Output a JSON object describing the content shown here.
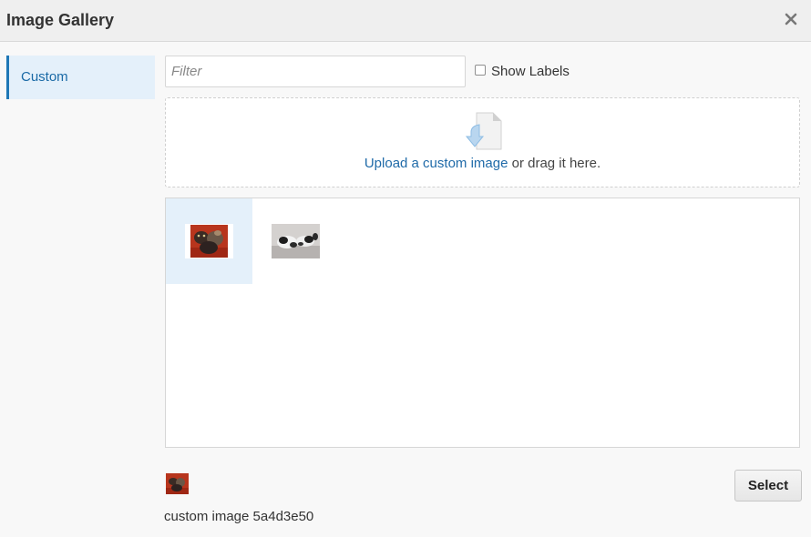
{
  "dialog": {
    "title": "Image Gallery",
    "close_icon": "close-icon"
  },
  "sidebar": {
    "items": [
      {
        "label": "Custom",
        "selected": true
      }
    ]
  },
  "filter": {
    "placeholder": "Filter",
    "value": ""
  },
  "show_labels": {
    "label": "Show Labels",
    "checked": false
  },
  "dropzone": {
    "icon": "upload-file-icon",
    "link_text": "Upload a custom image",
    "suffix_text": " or drag it here."
  },
  "gallery": {
    "items": [
      {
        "selected": true,
        "thumbnail": "red-cats-photo"
      },
      {
        "selected": false,
        "thumbnail": "black-white-cats-photo"
      }
    ]
  },
  "footer": {
    "caption": "custom image 5a4d3e50",
    "select_label": "Select"
  },
  "colors": {
    "accent": "#1e77b6",
    "link": "#1f6aa8",
    "selected_bg": "#e4f0fa"
  }
}
